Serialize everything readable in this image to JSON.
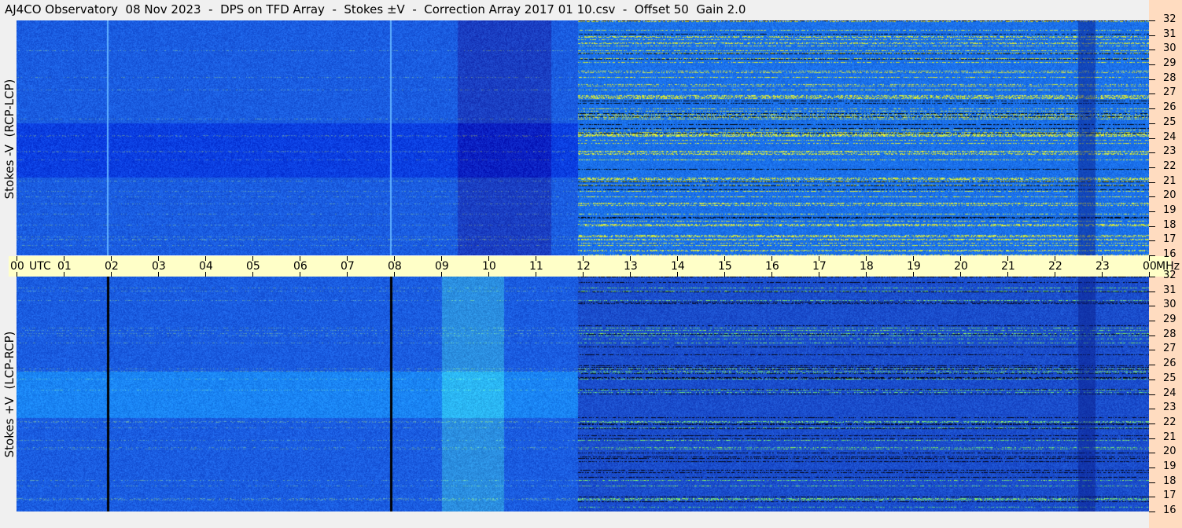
{
  "title": "AJ4CO Observatory  08 Nov 2023  -  DPS on TFD Array  -  Stokes ±V  -  Correction Array 2017 01 10.csv  -  Offset 50  Gain 2.0",
  "chart_data": {
    "type": "heatmap",
    "title": "AJ4CO Observatory  08 Nov 2023  -  DPS on TFD Array  -  Stokes ±V  -  Correction Array 2017 01 10.csv  -  Offset 50  Gain 2.0",
    "xlabel": "UTC",
    "ylabel": "MHz",
    "x_ticks": [
      "00",
      "01",
      "02",
      "03",
      "04",
      "05",
      "06",
      "07",
      "08",
      "09",
      "10",
      "11",
      "12",
      "13",
      "14",
      "15",
      "16",
      "17",
      "18",
      "19",
      "20",
      "21",
      "22",
      "23",
      "00"
    ],
    "x_range_hours": [
      0,
      24
    ],
    "y_ticks": [
      "16",
      "17",
      "18",
      "19",
      "20",
      "21",
      "22",
      "23",
      "24",
      "25",
      "26",
      "27",
      "28",
      "29",
      "30",
      "31",
      "32"
    ],
    "y_range_mhz": [
      16,
      32
    ],
    "panels": [
      {
        "name": "Stokes -V (RCP-LCP)",
        "label": "Stokes -V  (RCP-LCP)",
        "vertical_lines_utc": [
          1.92,
          7.92
        ],
        "line_color": "#60b0ff"
      },
      {
        "name": "Stokes +V (LCP-RCP)",
        "label": "Stokes +V  (LCP-RCP)",
        "vertical_lines_utc": [
          1.92,
          7.92
        ],
        "line_color": "#000000"
      }
    ],
    "colormap": [
      "#000000",
      "#1030c0",
      "#1a5ce0",
      "#2a90f0",
      "#40d0e0",
      "#c0f040",
      "#ff4080"
    ],
    "interference_onset_utc": 11.9
  }
}
